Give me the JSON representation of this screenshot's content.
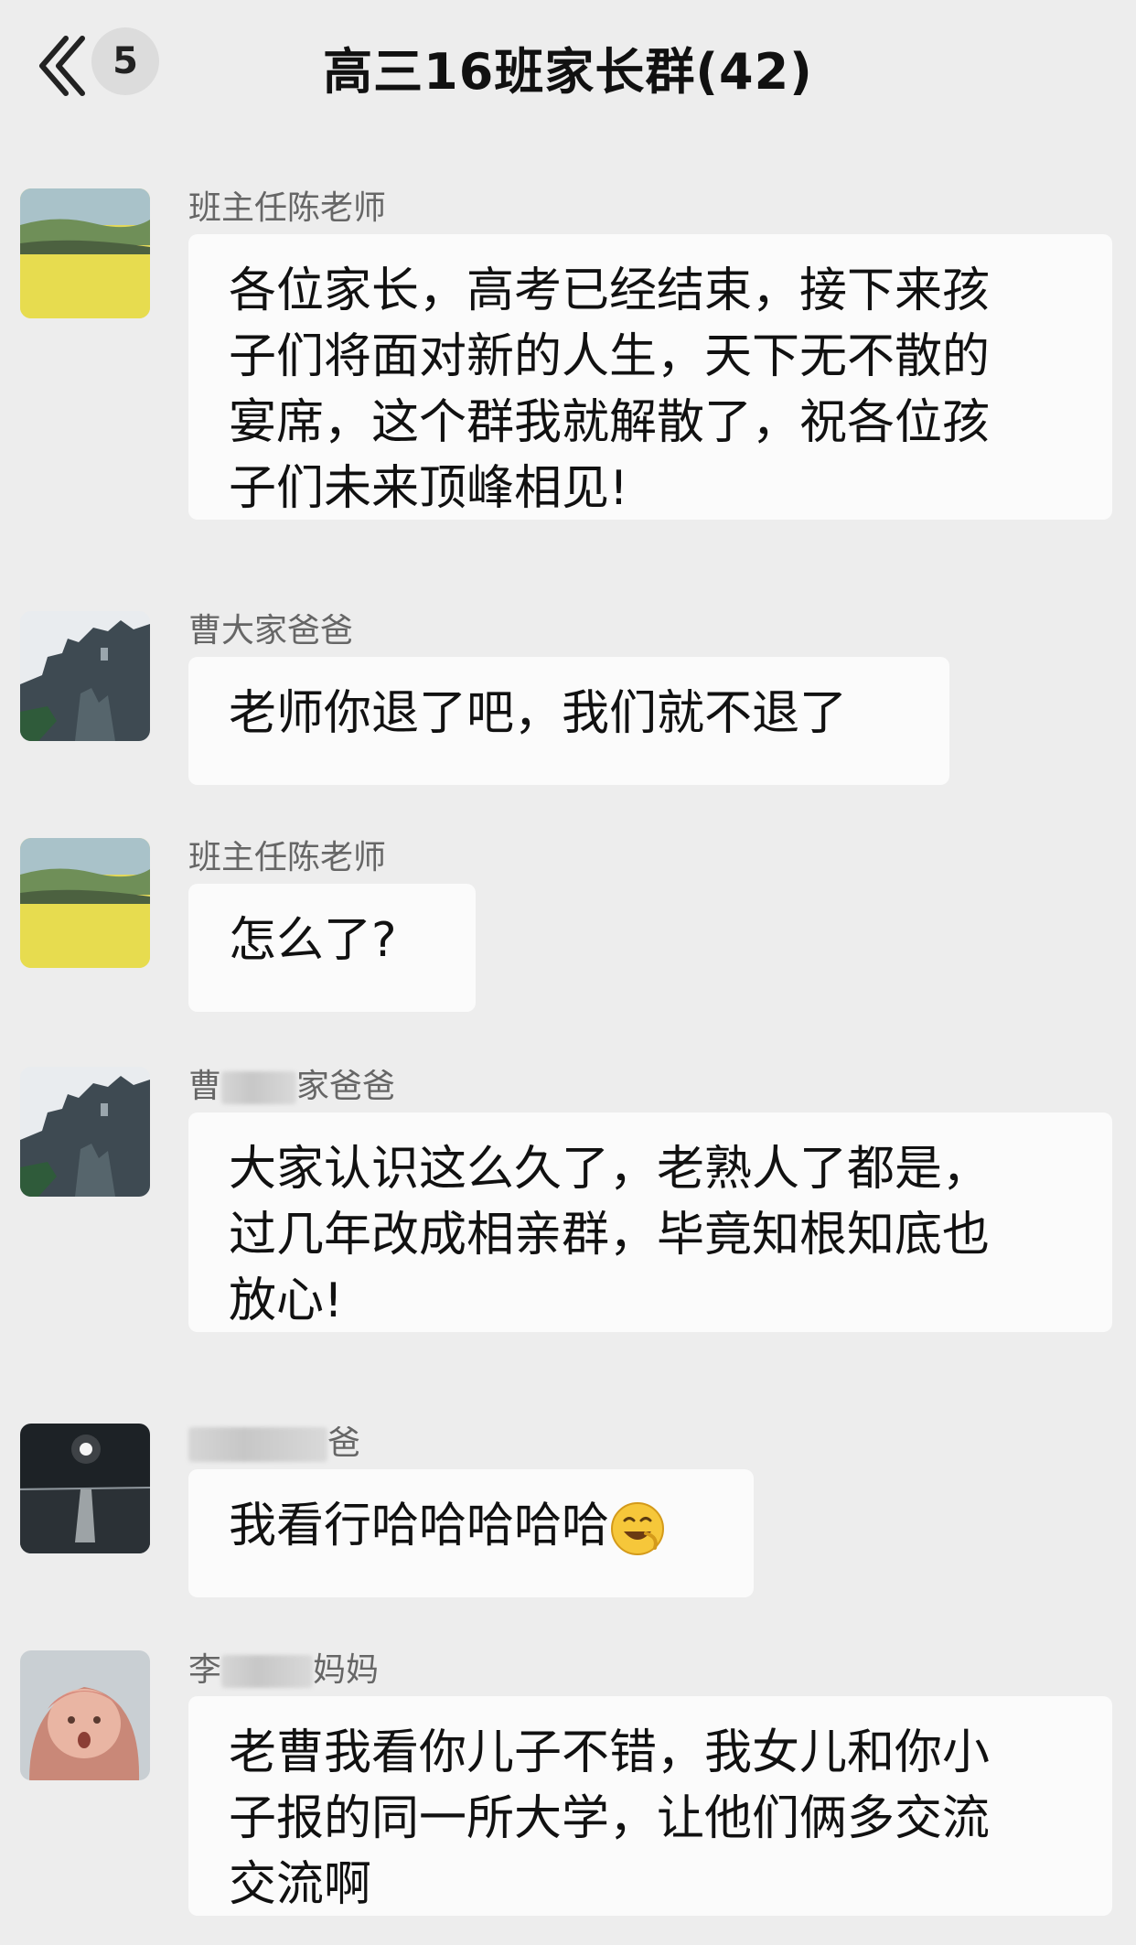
{
  "header": {
    "back_label": "返回",
    "unread_count": "5",
    "title": "高三16班家长群(42)"
  },
  "messages": [
    {
      "sender": "班主任陈老师",
      "lines": [
        "各位家长，高考已经结束，接下来孩",
        "子们将面对新的人生，天下无不散的",
        "宴席，这个群我就解散了，祝各位孩",
        "子们未来顶峰相见!"
      ],
      "avatar_icon": "field-landscape-icon"
    },
    {
      "sender": "曹大家爸爸",
      "lines": [
        "老师你退了吧，我们就不退了"
      ],
      "avatar_icon": "castle-landscape-icon"
    },
    {
      "sender": "班主任陈老师",
      "lines": [
        "怎么了?"
      ],
      "avatar_icon": "field-landscape-icon"
    },
    {
      "sender_visible_start": "曹",
      "sender_visible_end": "家爸爸",
      "lines": [
        "大家认识这么久了，老熟人了都是，",
        "过几年改成相亲群，毕竟知根知底也",
        "放心!"
      ],
      "avatar_icon": "castle-landscape-icon"
    },
    {
      "sender_visible_end": "爸",
      "lines": [
        "我看行哈哈哈哈哈"
      ],
      "emoji": "grinning-face-icon",
      "avatar_icon": "moon-night-sea-icon"
    },
    {
      "sender_visible_start": "李",
      "sender_visible_end": "妈妈",
      "lines": [
        "老曹我看你儿子不错，我女儿和你小",
        "子报的同一所大学，让他们俩多交流",
        "交流啊"
      ],
      "avatar_icon": "baby-photo-icon"
    }
  ],
  "colors": {
    "background": "#ededed",
    "bubble": "#fbfbfb",
    "sender_text": "#666666"
  }
}
